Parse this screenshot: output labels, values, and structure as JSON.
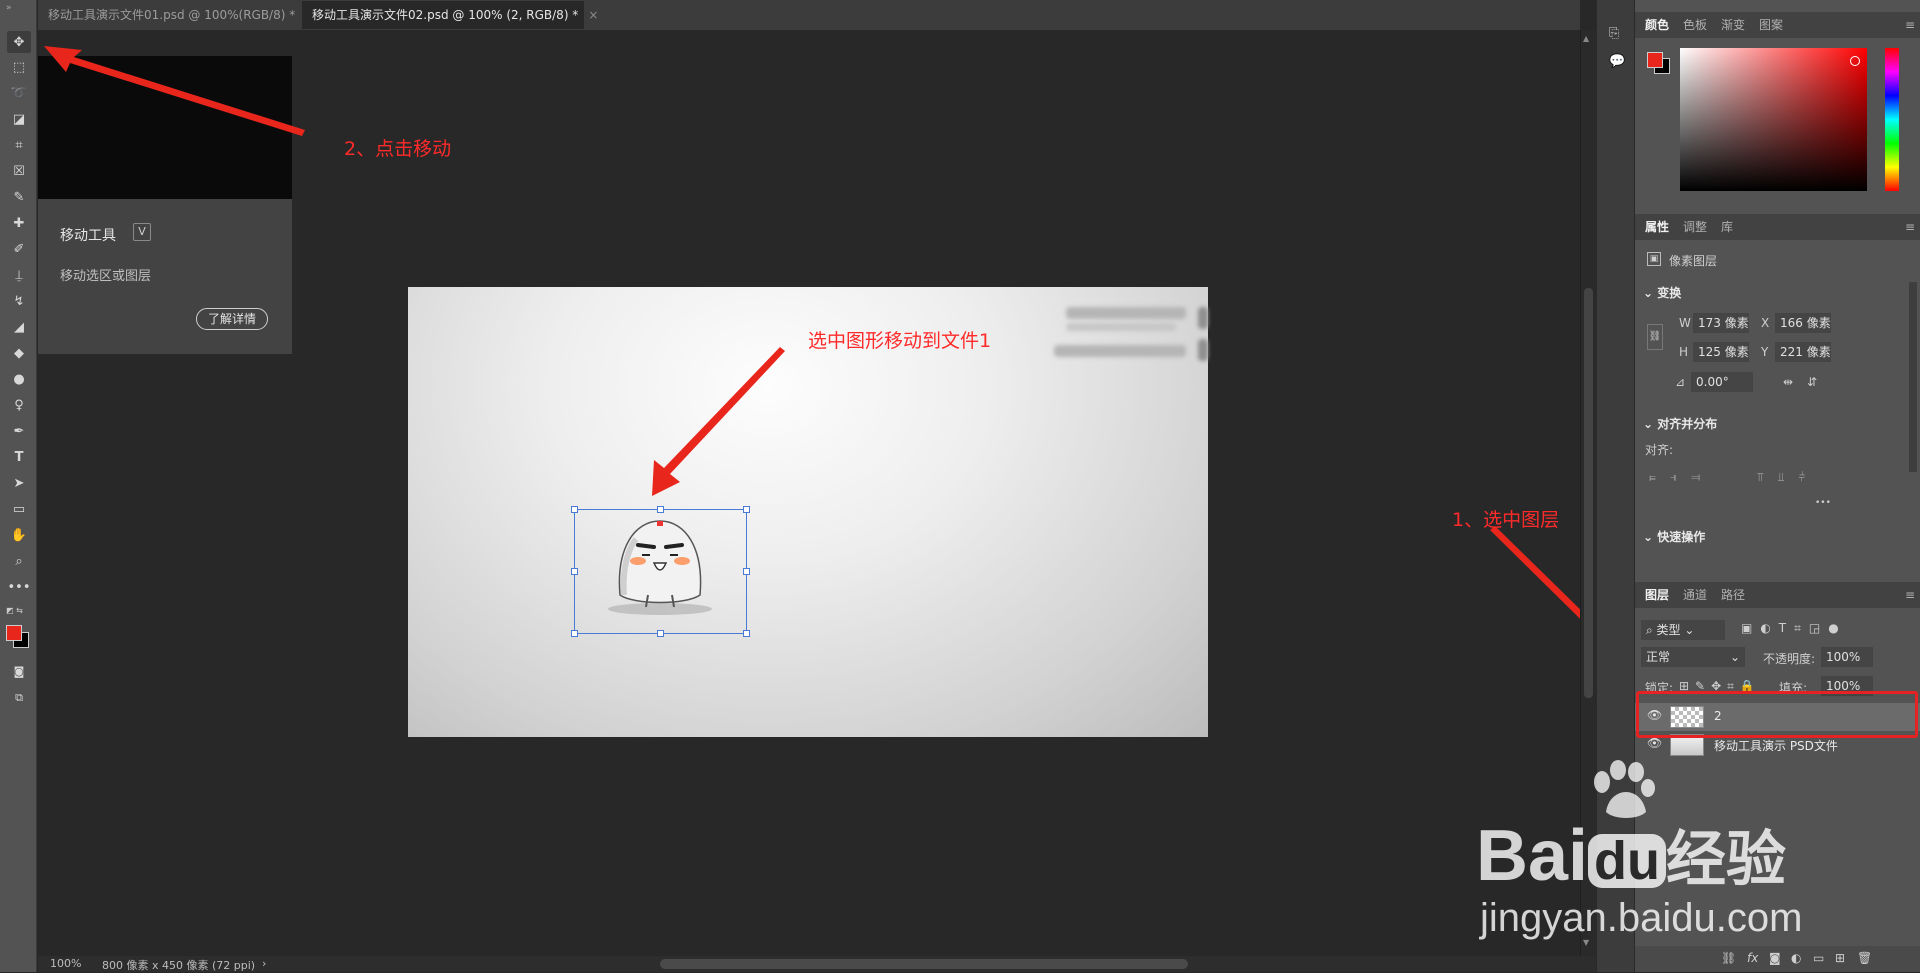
{
  "tabs": [
    {
      "label": "移动工具演示文件01.psd @ 100%(RGB/8) *",
      "close": "×"
    },
    {
      "label": "移动工具演示文件02.psd @ 100% (2, RGB/8) *",
      "close": "×"
    }
  ],
  "tools": [
    "move-icon",
    "marquee-icon",
    "lasso-icon",
    "object-select-icon",
    "crop-icon",
    "frame-icon",
    "eyedropper-icon",
    "healing-icon",
    "brush-icon",
    "stamp-icon",
    "history-brush-icon",
    "eraser-icon",
    "paint-bucket-icon",
    "blur-icon",
    "dodge-icon",
    "pen-icon",
    "type-icon",
    "path-select-icon",
    "rectangle-icon",
    "hand-icon",
    "zoom-icon",
    "more-icon"
  ],
  "tooltip": {
    "title": "移动工具",
    "shortcut": "V",
    "description": "移动选区或图层",
    "learn_more": "了解详情"
  },
  "annotations": {
    "step2": "2、点击移动",
    "move_to_file": "选中图形移动到文件1",
    "step1": "1、选中图层"
  },
  "status": {
    "zoom": "100%",
    "doc_info": "800 像素 x 450 像素 (72 ppi)",
    "arrow": "›"
  },
  "color_panel": {
    "tabs": [
      "颜色",
      "色板",
      "渐变",
      "图案"
    ],
    "foreground": "#e8261c",
    "background": "#000000"
  },
  "properties_panel": {
    "tabs": [
      "属性",
      "调整",
      "库"
    ],
    "layer_type": "像素图层",
    "transform": {
      "title": "变换",
      "w_label": "W",
      "w": "173 像素",
      "x_label": "X",
      "x": "166 像素",
      "h_label": "H",
      "h": "125 像素",
      "y_label": "Y",
      "y": "221 像素",
      "angle": "0.00°"
    },
    "align": {
      "title": "对齐并分布",
      "label": "对齐:",
      "more": "•••"
    },
    "quick": {
      "title": "快速操作"
    }
  },
  "layers_panel": {
    "tabs": [
      "图层",
      "通道",
      "路径"
    ],
    "filter": "类型",
    "blend_mode": "正常",
    "opacity_label": "不透明度:",
    "opacity": "100%",
    "lock_label": "锁定:",
    "fill_label": "填充:",
    "fill": "100%",
    "layers": [
      {
        "name": "2",
        "selected": true
      },
      {
        "name": "移动工具演示 PSD文件",
        "selected": false
      }
    ],
    "footer": [
      "link-icon",
      "fx-icon",
      "mask-icon",
      "adjustment-icon",
      "group-icon",
      "new-layer-icon",
      "trash-icon"
    ],
    "fx_label": "fx"
  },
  "watermark": {
    "brand": "Bai",
    "du": "du",
    "suffix": "经验",
    "url": "jingyan.baidu.com"
  }
}
